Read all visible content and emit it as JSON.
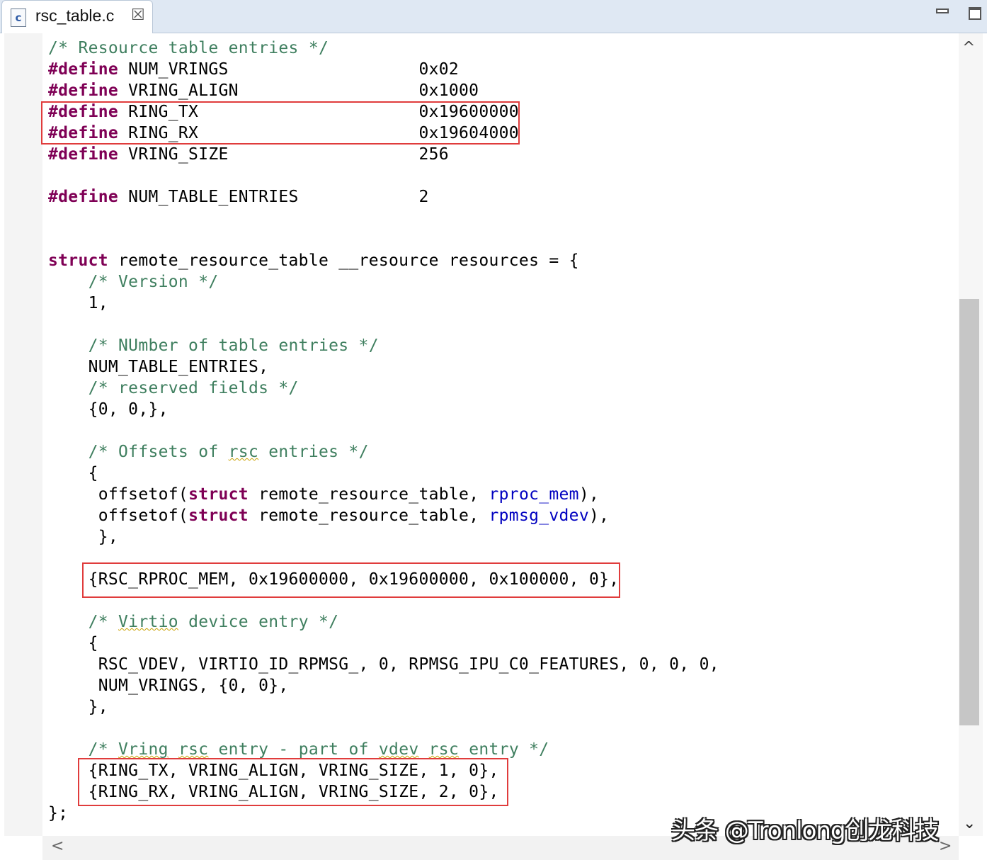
{
  "tab": {
    "title": "rsc_table.c",
    "icon_label": "c",
    "close_glyph": "☒"
  },
  "scrollbar": {
    "up": "^",
    "left": "<",
    "right": ">"
  },
  "watermark": "头条 @Tronlong创龙科技",
  "code_lines": [
    [
      {
        "t": "/* Resource table entries */",
        "c": "cm"
      }
    ],
    [
      {
        "t": "#define",
        "c": "kw"
      },
      {
        "t": " NUM_VRINGS                   0x02"
      }
    ],
    [
      {
        "t": "#define",
        "c": "kw"
      },
      {
        "t": " VRING_ALIGN                  0x1000"
      }
    ],
    [
      {
        "t": "#define",
        "c": "kw"
      },
      {
        "t": " RING_TX                      0x19600000"
      }
    ],
    [
      {
        "t": "#define",
        "c": "kw"
      },
      {
        "t": " RING_RX                      0x19604000"
      }
    ],
    [
      {
        "t": "#define",
        "c": "kw"
      },
      {
        "t": " VRING_SIZE                   256"
      }
    ],
    [],
    [
      {
        "t": "#define",
        "c": "kw"
      },
      {
        "t": " NUM_TABLE_ENTRIES            2"
      }
    ],
    [],
    [],
    [
      {
        "t": "struct",
        "c": "kw"
      },
      {
        "t": " remote_resource_table __resource resources = {"
      }
    ],
    [
      {
        "t": "    /* Version */",
        "c": "cm"
      }
    ],
    [
      {
        "t": "    1,"
      }
    ],
    [],
    [
      {
        "t": "    /* NUmber of table entries */",
        "c": "cm"
      }
    ],
    [
      {
        "t": "    NUM_TABLE_ENTRIES,"
      }
    ],
    [
      {
        "t": "    /* reserved fields */",
        "c": "cm"
      }
    ],
    [
      {
        "t": "    {0, 0,},"
      }
    ],
    [],
    [
      {
        "t": "    /* Offsets of ",
        "c": "cm"
      },
      {
        "t": "rsc",
        "c": "cm sq"
      },
      {
        "t": " entries */",
        "c": "cm"
      }
    ],
    [
      {
        "t": "    {"
      }
    ],
    [
      {
        "t": "     offsetof("
      },
      {
        "t": "struct",
        "c": "kw"
      },
      {
        "t": " remote_resource_table, "
      },
      {
        "t": "rproc_mem",
        "c": "fld"
      },
      {
        "t": "),"
      }
    ],
    [
      {
        "t": "     offsetof("
      },
      {
        "t": "struct",
        "c": "kw"
      },
      {
        "t": " remote_resource_table, "
      },
      {
        "t": "rpmsg_vdev",
        "c": "fld"
      },
      {
        "t": "),"
      }
    ],
    [
      {
        "t": "     },"
      }
    ],
    [],
    [
      {
        "t": "    {RSC_RPROC_MEM, 0x19600000, 0x19600000, 0x100000, 0},"
      }
    ],
    [],
    [
      {
        "t": "    /* ",
        "c": "cm"
      },
      {
        "t": "Virtio",
        "c": "cm sq"
      },
      {
        "t": " device entry */",
        "c": "cm"
      }
    ],
    [
      {
        "t": "    {"
      }
    ],
    [
      {
        "t": "     RSC_VDEV, VIRTIO_ID_RPMSG_, 0, RPMSG_IPU_C0_FEATURES, 0, 0, 0,"
      }
    ],
    [
      {
        "t": "     NUM_VRINGS, {0, 0},"
      }
    ],
    [
      {
        "t": "    },"
      }
    ],
    [],
    [
      {
        "t": "    /* ",
        "c": "cm"
      },
      {
        "t": "Vring",
        "c": "cm sq"
      },
      {
        "t": " ",
        "c": "cm"
      },
      {
        "t": "rsc",
        "c": "cm sq"
      },
      {
        "t": " entry - part of ",
        "c": "cm"
      },
      {
        "t": "vdev",
        "c": "cm sq"
      },
      {
        "t": " ",
        "c": "cm"
      },
      {
        "t": "rsc",
        "c": "cm sq"
      },
      {
        "t": " entry */",
        "c": "cm"
      }
    ],
    [
      {
        "t": "    {RING_TX, VRING_ALIGN, VRING_SIZE, 1, 0},"
      }
    ],
    [
      {
        "t": "    {RING_RX, VRING_ALIGN, VRING_SIZE, 2, 0},"
      }
    ],
    [
      {
        "t": "};"
      }
    ]
  ]
}
